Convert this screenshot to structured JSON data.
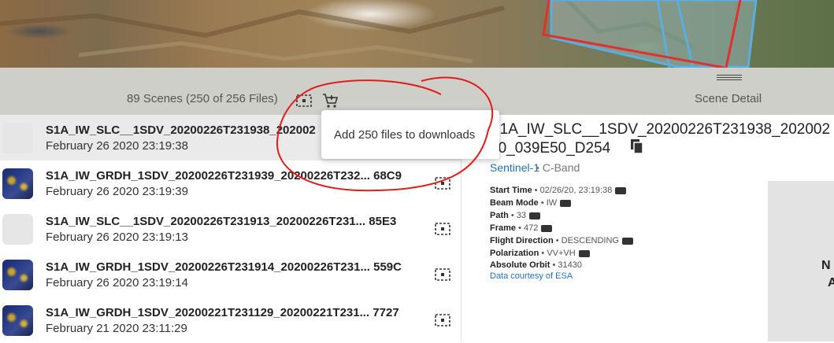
{
  "header": {
    "scene_count": "89 Scenes (250 of 256 Files)",
    "scene_detail": "Scene Detail",
    "icons": [
      "footprint-icon",
      "add-to-cart-icon"
    ]
  },
  "scenes": [
    {
      "title": "S1A_IW_SLC__1SDV_20200226T231938_202002",
      "date": "February 26 2020 23:19:38",
      "thumbnail": "none",
      "selected": true
    },
    {
      "title": "S1A_IW_GRDH_1SDV_20200226T231939_20200226T232... 68C9",
      "date": "February 26 2020 23:19:39",
      "thumbnail": "image"
    },
    {
      "title": "S1A_IW_SLC__1SDV_20200226T231913_20200226T231... 85E3",
      "date": "February 26 2020 23:19:13",
      "thumbnail": "none"
    },
    {
      "title": "S1A_IW_GRDH_1SDV_20200226T231914_20200226T231... 559C",
      "date": "February 26 2020 23:19:14",
      "thumbnail": "image"
    },
    {
      "title": "S1A_IW_GRDH_1SDV_20200221T231129_20200221T231... 7727",
      "date": "February 21 2020 23:11:29",
      "thumbnail": "image"
    }
  ],
  "tooltip": {
    "text": "Add 250 files to downloads"
  },
  "detail": {
    "title_line1": "S1A_IW_SLC__1SDV_20200226T231938_202002",
    "title_line2": "30_039E50_D254",
    "platform": "Sentinel-1",
    "band": "• C-Band",
    "properties": [
      {
        "label": "Start Time",
        "value": "• 02/26/20, 23:19:38"
      },
      {
        "label": "Beam Mode",
        "value": "• IW"
      },
      {
        "label": "Path",
        "value": "• 33"
      },
      {
        "label": "Frame",
        "value": "• 472"
      },
      {
        "label": "Flight Direction",
        "value": "• DESCENDING"
      },
      {
        "label": "Polarization",
        "value": "• VV+VH"
      },
      {
        "label": "Absolute Orbit",
        "value": "• 31430"
      }
    ],
    "courtesy": "Data courtesy of ESA",
    "preview_text_line1": "N",
    "preview_text_line2": "A"
  },
  "colors": {
    "link": "#1f73b7",
    "header_bg": "#cfcfca",
    "selected_row": "#eaeaea",
    "footprint_red": "#e03030",
    "footprint_blue": "#5aaee0"
  }
}
